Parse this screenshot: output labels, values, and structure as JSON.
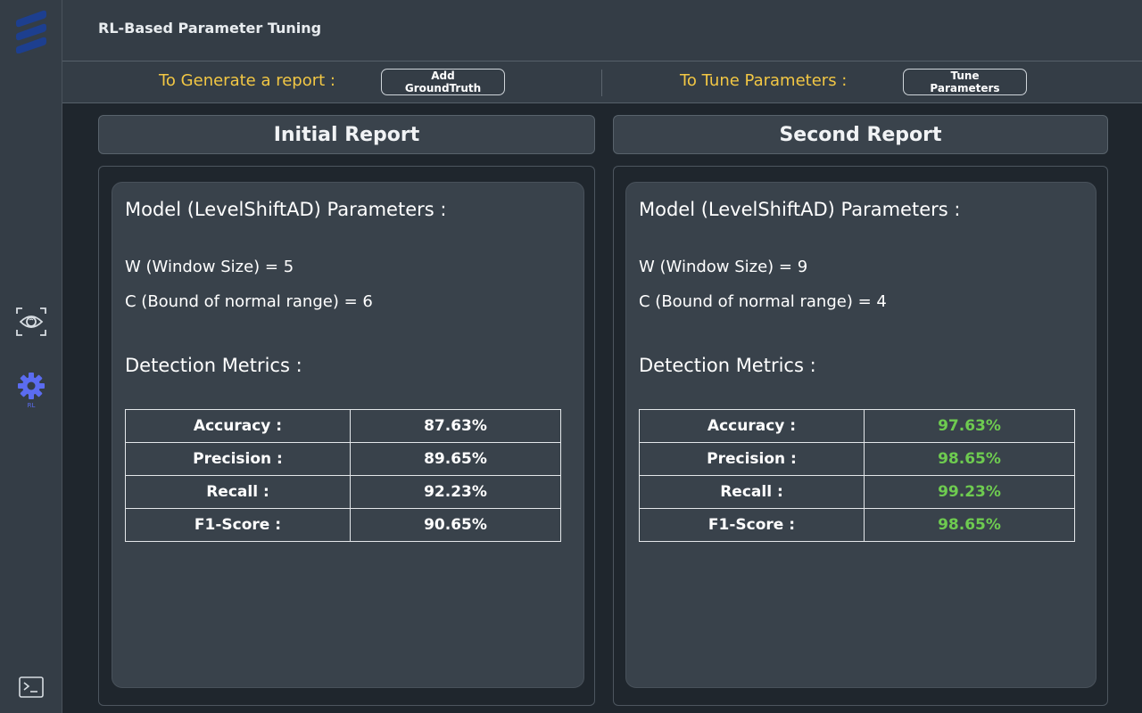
{
  "header": {
    "title": "RL-Based Parameter Tuning"
  },
  "sidebar": {
    "logo_icon": "ericsson-logo-icon",
    "items": [
      {
        "icon": "eye-icon",
        "label": ""
      },
      {
        "icon": "gear-icon",
        "label": "RL"
      }
    ],
    "bottom_icon": "terminal-icon",
    "active_color": "#5b6cf0"
  },
  "actions": {
    "generate_label": "To Generate a report :",
    "generate_button": "Add GroundTruth",
    "tune_label": "To Tune Parameters :",
    "tune_button": "Tune Parameters",
    "label_color": "#f2c744"
  },
  "reports": [
    {
      "header": "Initial Report",
      "params_title": "Model (LevelShiftAD) Parameters :",
      "param_w": "W (Window Size) = 5",
      "param_c": "C (Bound of normal range) = 6",
      "metrics_title": "Detection Metrics :",
      "metrics": [
        {
          "label": "Accuracy :",
          "value": "87.63%"
        },
        {
          "label": "Precision :",
          "value": "89.65%"
        },
        {
          "label": "Recall :",
          "value": "92.23%"
        },
        {
          "label": "F1-Score :",
          "value": "90.65%"
        }
      ]
    },
    {
      "header": "Second Report",
      "params_title": "Model (LevelShiftAD) Parameters :",
      "param_w": "W (Window Size) = 9",
      "param_c": "C (Bound of normal range) = 4",
      "metrics_title": "Detection Metrics :",
      "metrics": [
        {
          "label": "Accuracy :",
          "value": "97.63%"
        },
        {
          "label": "Precision :",
          "value": "98.65%"
        },
        {
          "label": "Recall :",
          "value": "99.23%"
        },
        {
          "label": "F1-Score :",
          "value": "98.65%"
        }
      ],
      "value_color": "#6ecb50"
    }
  ]
}
